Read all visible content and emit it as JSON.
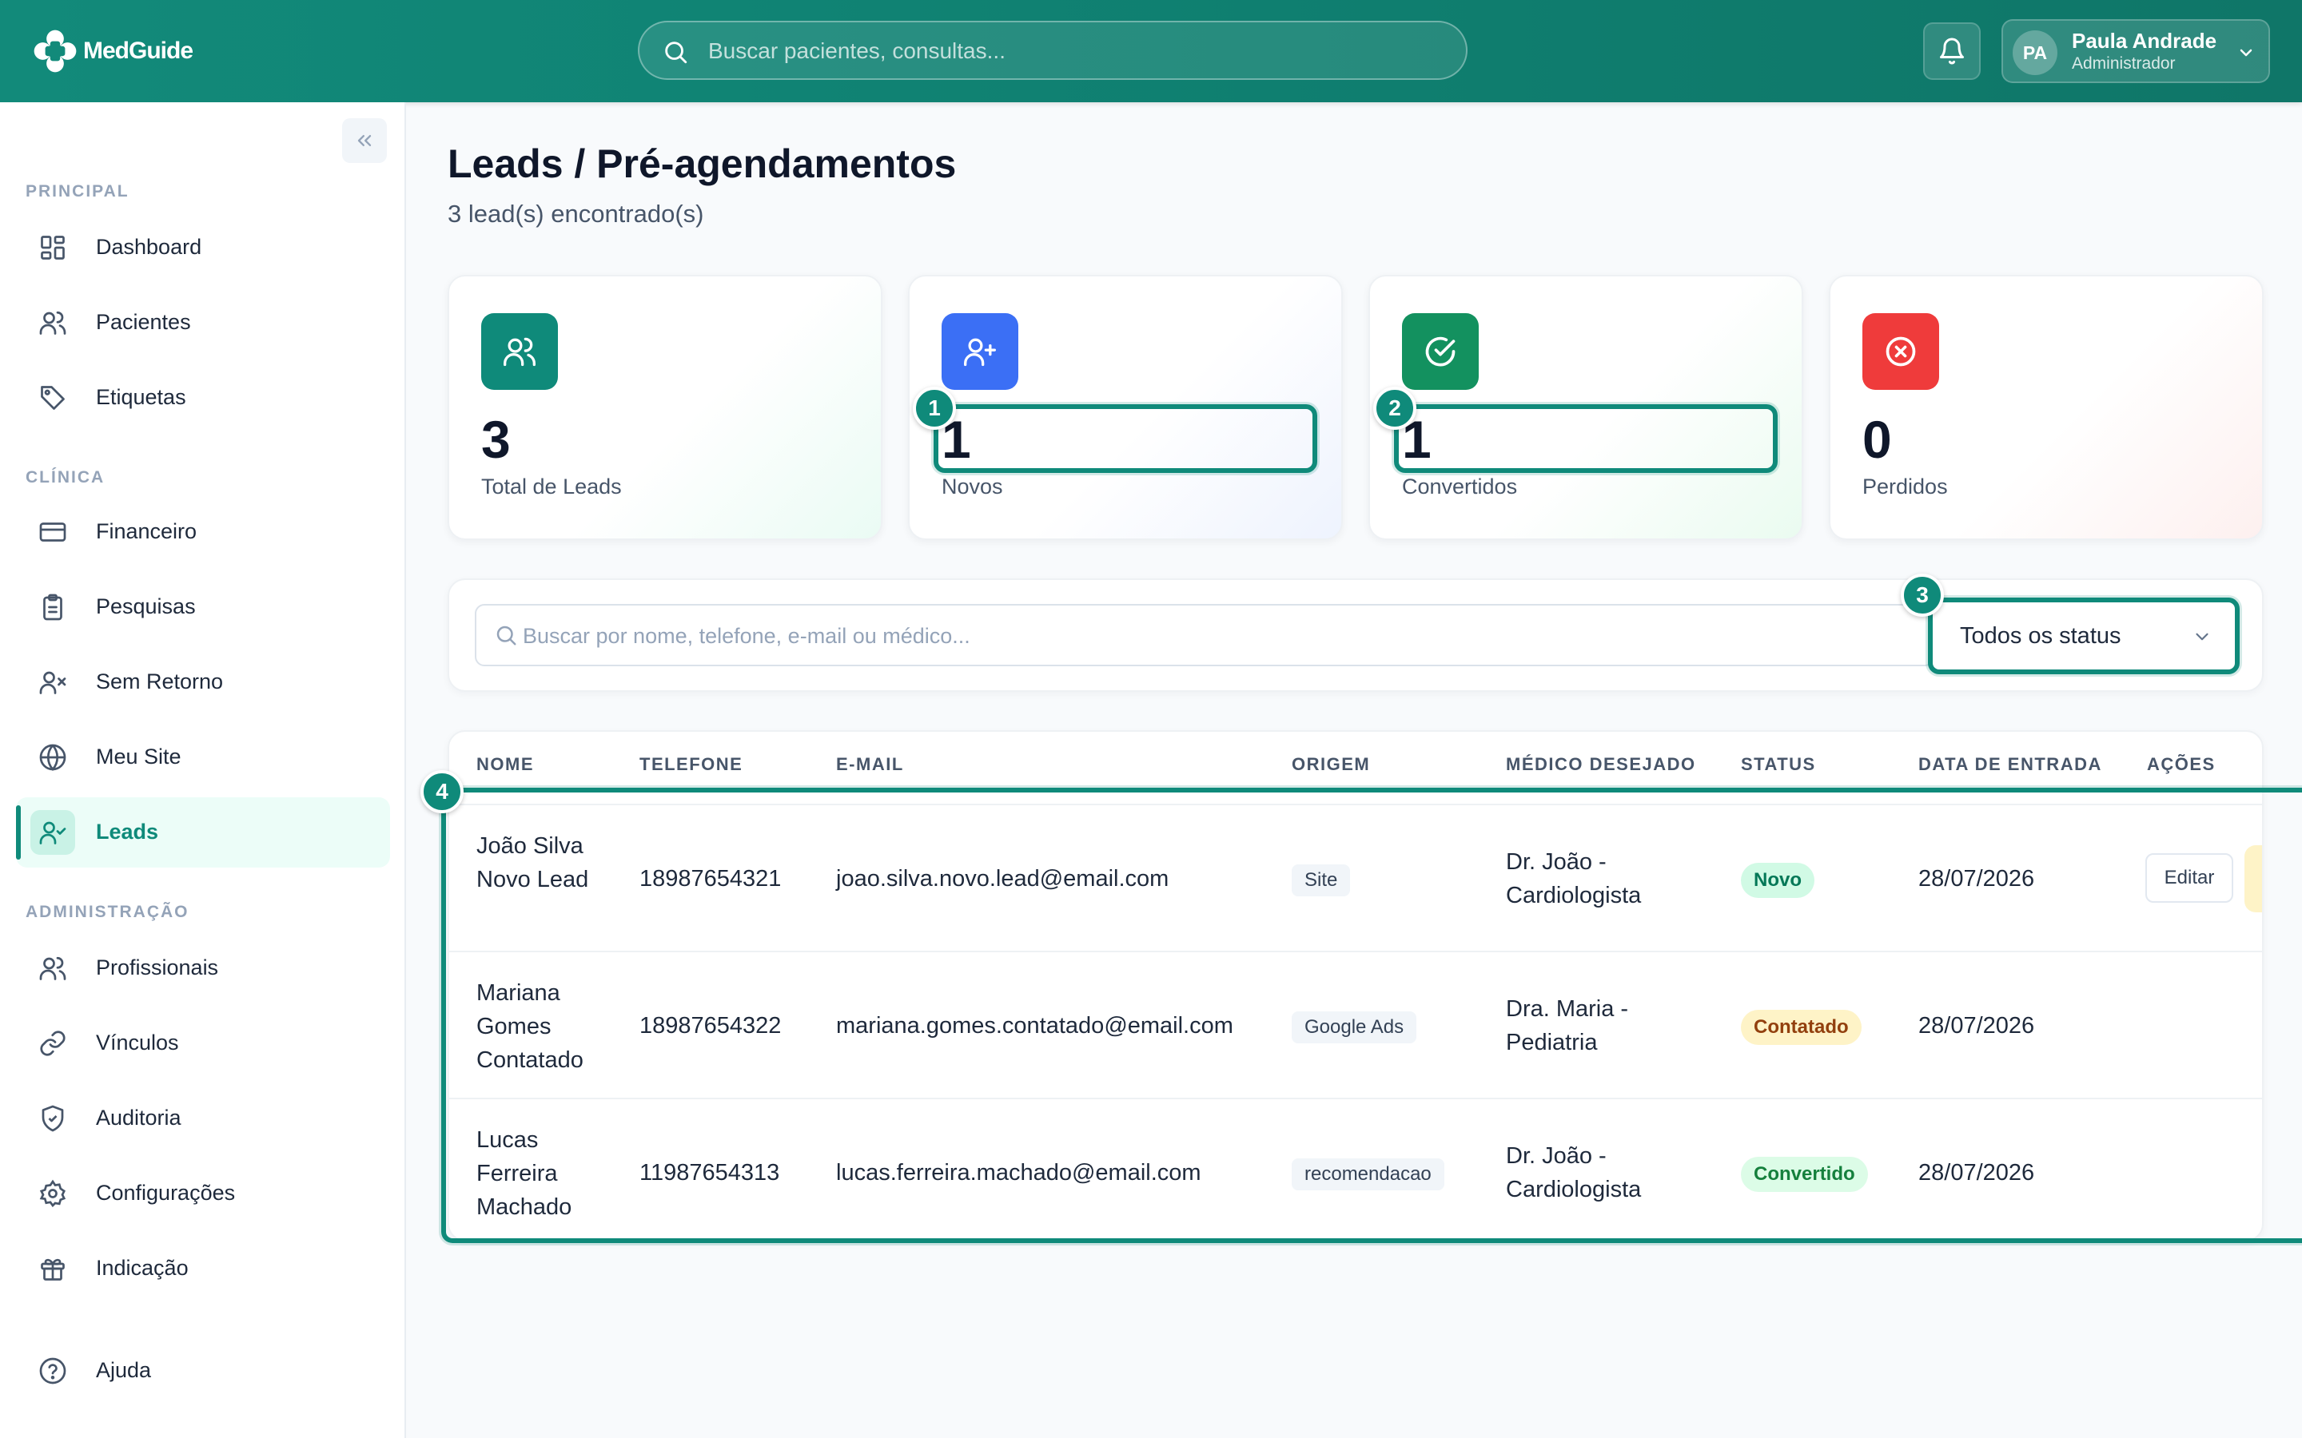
{
  "app": {
    "name": "MedGuide"
  },
  "topbar": {
    "search_placeholder": "Buscar pacientes, consultas...",
    "user": {
      "initials": "PA",
      "name": "Paula Andrade",
      "role": "Administrador"
    }
  },
  "sidebar": {
    "sections": [
      "PRINCIPAL",
      "CLÍNICA",
      "ADMINISTRAÇÃO"
    ],
    "items": [
      {
        "label": "Dashboard",
        "icon": "dashboard-icon"
      },
      {
        "label": "Pacientes",
        "icon": "users-icon"
      },
      {
        "label": "Etiquetas",
        "icon": "tag-icon"
      },
      {
        "label": "Financeiro",
        "icon": "credit-card-icon"
      },
      {
        "label": "Pesquisas",
        "icon": "clipboard-icon"
      },
      {
        "label": "Sem Retorno",
        "icon": "user-x-icon"
      },
      {
        "label": "Meu Site",
        "icon": "globe-icon"
      },
      {
        "label": "Leads",
        "icon": "user-check-icon",
        "active": true
      },
      {
        "label": "Profissionais",
        "icon": "user-icon"
      },
      {
        "label": "Vínculos",
        "icon": "link-icon"
      },
      {
        "label": "Auditoria",
        "icon": "shield-icon"
      },
      {
        "label": "Configurações",
        "icon": "gear-icon"
      },
      {
        "label": "Indicação",
        "icon": "gift-icon"
      },
      {
        "label": "Ajuda",
        "icon": "help-icon"
      }
    ]
  },
  "page": {
    "title": "Leads / Pré-agendamentos",
    "subtitle": "3 lead(s) encontrado(s)"
  },
  "stats": [
    {
      "value": "3",
      "label": "Total de Leads",
      "color": "#0f8a7a"
    },
    {
      "value": "1",
      "label": "Novos",
      "color": "#3b6ff5"
    },
    {
      "value": "1",
      "label": "Convertidos",
      "color": "#13915f"
    },
    {
      "value": "0",
      "label": "Perdidos",
      "color": "#ef3b3b"
    }
  ],
  "filters": {
    "search_placeholder": "Buscar por nome, telefone, e-mail ou médico...",
    "status_selected": "Todos os status"
  },
  "annotations": [
    "1",
    "2",
    "3",
    "4"
  ],
  "table": {
    "headers": [
      "NOME",
      "TELEFONE",
      "E-MAIL",
      "ORIGEM",
      "MÉDICO DESEJADO",
      "STATUS",
      "DATA DE ENTRADA",
      "AÇÕES"
    ],
    "edit_label": "Editar",
    "rows": [
      {
        "name": "João Silva Novo Lead",
        "phone": "18987654321",
        "email": "joao.silva.novo.lead@email.com",
        "origin": "Site",
        "doctor": "Dr. João - Cardiologista",
        "status": "Novo",
        "date": "28/07/2026"
      },
      {
        "name": "Mariana Gomes Contatado",
        "phone": "18987654322",
        "email": "mariana.gomes.contatado@email.com",
        "origin": "Google Ads",
        "doctor": "Dra. Maria - Pediatria",
        "status": "Contatado",
        "date": "28/07/2026"
      },
      {
        "name": "Lucas Ferreira Machado",
        "phone": "11987654313",
        "email": "lucas.ferreira.machado@email.com",
        "origin": "recomendacao",
        "doctor": "Dr. João - Cardiologista",
        "status": "Convertido",
        "date": "28/07/2026"
      }
    ]
  },
  "status_colors": {
    "Novo": {
      "bg": "#d1fae5",
      "fg": "#047857"
    },
    "Contatado": {
      "bg": "#fef3c7",
      "fg": "#92400e"
    },
    "Convertido": {
      "bg": "#dcfce7",
      "fg": "#15803d"
    }
  }
}
